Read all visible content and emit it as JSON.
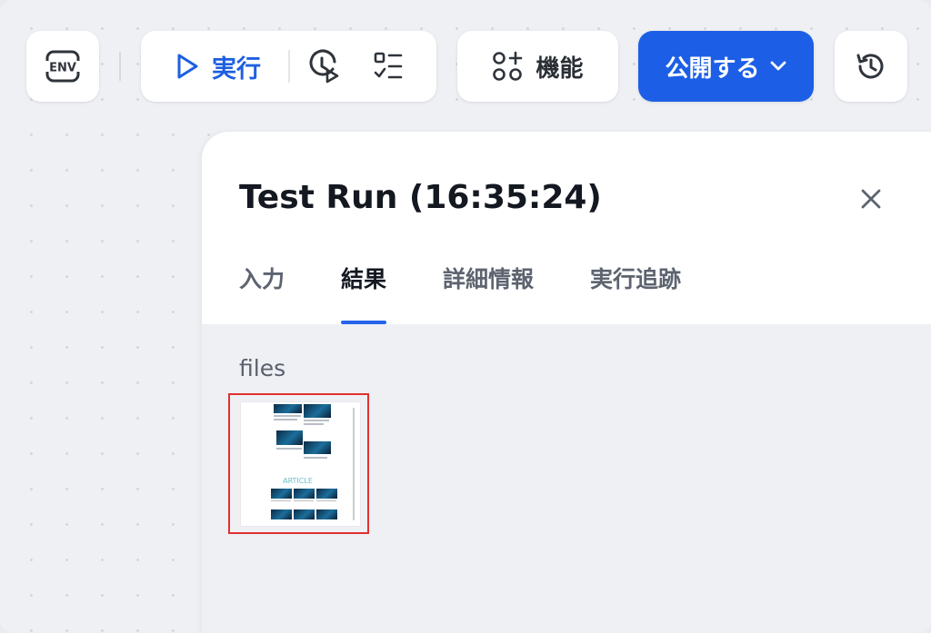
{
  "toolbar": {
    "env_label": "ENV",
    "run_label": "実行",
    "features_label": "機能",
    "publish_label": "公開する"
  },
  "panel": {
    "title": "Test Run (16:35:24)",
    "tabs": [
      {
        "label": "入力",
        "active": false
      },
      {
        "label": "結果",
        "active": true
      },
      {
        "label": "詳細情報",
        "active": false
      },
      {
        "label": "実行追跡",
        "active": false
      }
    ],
    "files_label": "files",
    "thumbnail_caption": "ARTICLE"
  },
  "colors": {
    "accent": "#1c5fe6",
    "selection_border": "#e0312f"
  }
}
